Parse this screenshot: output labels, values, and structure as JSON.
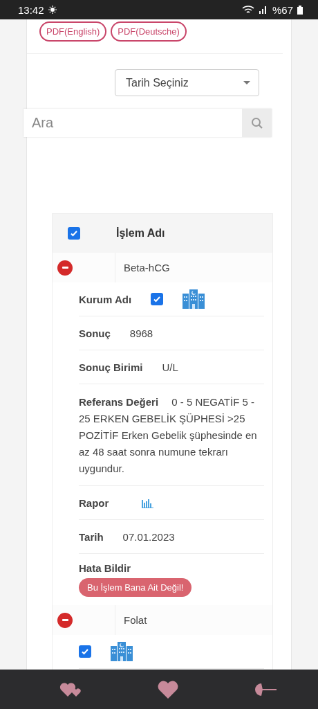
{
  "status_bar": {
    "time": "13:42",
    "battery": "%67"
  },
  "pdf_buttons": [
    "PDF(English)",
    "PDF(Deutsche)"
  ],
  "date_select": {
    "value": "Tarih Seçiniz"
  },
  "search": {
    "placeholder": "Ara"
  },
  "table": {
    "header": {
      "label": "İşlem Adı",
      "checked": true
    },
    "items": [
      {
        "name": "Beta-hCG",
        "expanded": true,
        "details": [
          {
            "kind": "checkbox",
            "label": "Kurum Adı",
            "checked": true
          },
          {
            "kind": "text",
            "label": "Sonuç",
            "value": "8968"
          },
          {
            "kind": "text",
            "label": "Sonuç Birimi",
            "value": "U/L"
          },
          {
            "kind": "wrap",
            "label": "Referans Değeri",
            "value": "0 - 5 NEGATİF 5 - 25 ERKEN GEBELİK ŞÜPHESİ >25 POZİTİF Erken Gebelik şüphesinde en az 48 saat sonra numune tekrarı uygundur."
          },
          {
            "kind": "chart",
            "label": "Rapor"
          },
          {
            "kind": "text",
            "label": "Tarih",
            "value": "07.01.2023"
          },
          {
            "kind": "action",
            "label": "Hata Bildir",
            "button": "Bu İşlem Bana Ait Değil!"
          }
        ]
      },
      {
        "name": "Folat",
        "expanded": true,
        "details": [
          {
            "kind": "checkbox",
            "checked": true
          }
        ]
      }
    ]
  }
}
